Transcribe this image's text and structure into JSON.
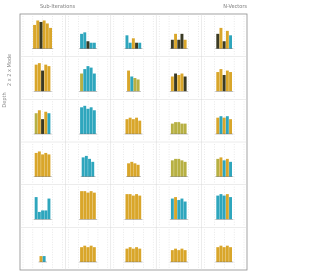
{
  "figure": {
    "top_left_text": "Sub-Iterations",
    "top_right_text": "N-Vectors",
    "row_group_labels": [
      "2 x 2 x Mode",
      "Depth"
    ],
    "col_labels": [
      "",
      "",
      "",
      "",
      ""
    ],
    "row_labels": [
      "",
      "",
      "",
      "",
      "",
      ""
    ],
    "colors": {
      "gold": "#d9a62a",
      "dark": "#3a3a24",
      "olive": "#b7b043",
      "teal": "#2ea6bd",
      "grid": "#c8c8c8",
      "frame": "#8c8c8c"
    }
  },
  "chart_data": {
    "type": "bar",
    "grid": true,
    "rows": 6,
    "cols": 5,
    "ylim": [
      0,
      1
    ],
    "panels": [
      [
        {
          "colors": [
            "gold",
            "gold",
            "dark",
            "gold",
            "gold",
            "gold"
          ],
          "values": [
            0.8,
            0.95,
            0.9,
            0.95,
            0.85,
            0.7
          ]
        },
        {
          "colors": [
            "teal",
            "teal",
            "dark",
            "teal",
            "teal"
          ],
          "values": [
            0.5,
            0.55,
            0.25,
            0.2,
            0.2
          ]
        },
        {
          "colors": [
            "teal",
            "teal",
            "gold",
            "dark",
            "teal"
          ],
          "values": [
            0.45,
            0.2,
            0.35,
            0.2,
            0.2
          ]
        },
        {
          "colors": [
            "dark",
            "gold",
            "dark",
            "dark",
            "gold"
          ],
          "values": [
            0.3,
            0.5,
            0.3,
            0.5,
            0.3
          ]
        },
        {
          "colors": [
            "dark",
            "gold",
            "dark",
            "gold",
            "teal"
          ],
          "values": [
            0.5,
            0.7,
            0.25,
            0.6,
            0.45
          ]
        }
      ],
      [
        {
          "colors": [
            "gold",
            "gold",
            "dark",
            "gold",
            "gold"
          ],
          "values": [
            0.9,
            0.95,
            0.7,
            0.9,
            0.85
          ]
        },
        {
          "colors": [
            "olive",
            "teal",
            "teal",
            "teal",
            "teal"
          ],
          "values": [
            0.6,
            0.75,
            0.85,
            0.8,
            0.6
          ]
        },
        {
          "colors": [
            "gold",
            "teal",
            "olive",
            "olive"
          ],
          "values": [
            0.7,
            0.5,
            0.45,
            0.4
          ]
        },
        {
          "colors": [
            "gold",
            "dark",
            "gold",
            "gold",
            "dark"
          ],
          "values": [
            0.5,
            0.6,
            0.55,
            0.6,
            0.5
          ]
        },
        {
          "colors": [
            "gold",
            "gold",
            "dark",
            "gold",
            "gold"
          ],
          "values": [
            0.65,
            0.75,
            0.55,
            0.7,
            0.65
          ]
        }
      ],
      [
        {
          "colors": [
            "olive",
            "gold",
            "dark",
            "gold",
            "teal"
          ],
          "values": [
            0.7,
            0.8,
            0.5,
            0.75,
            0.7
          ]
        },
        {
          "colors": [
            "teal",
            "teal",
            "teal",
            "teal",
            "teal"
          ],
          "values": [
            0.9,
            0.95,
            0.85,
            0.9,
            0.8
          ]
        },
        {
          "colors": [
            "gold",
            "gold",
            "gold",
            "gold",
            "gold"
          ],
          "values": [
            0.5,
            0.55,
            0.5,
            0.55,
            0.45
          ]
        },
        {
          "colors": [
            "olive",
            "olive",
            "olive",
            "olive",
            "olive"
          ],
          "values": [
            0.35,
            0.4,
            0.4,
            0.35,
            0.35
          ]
        },
        {
          "colors": [
            "gold",
            "teal",
            "gold",
            "teal",
            "gold"
          ],
          "values": [
            0.55,
            0.6,
            0.55,
            0.6,
            0.5
          ]
        }
      ],
      [
        {
          "colors": [
            "gold",
            "gold",
            "gold",
            "gold",
            "gold"
          ],
          "values": [
            0.8,
            0.85,
            0.75,
            0.8,
            0.75
          ]
        },
        {
          "colors": [
            "teal",
            "teal",
            "teal",
            "teal"
          ],
          "values": [
            0.65,
            0.7,
            0.6,
            0.5
          ]
        },
        {
          "colors": [
            "gold",
            "gold",
            "gold",
            "gold"
          ],
          "values": [
            0.45,
            0.5,
            0.45,
            0.4
          ]
        },
        {
          "colors": [
            "olive",
            "olive",
            "olive",
            "olive",
            "olive"
          ],
          "values": [
            0.55,
            0.6,
            0.6,
            0.55,
            0.5
          ]
        },
        {
          "colors": [
            "olive",
            "gold",
            "teal",
            "gold",
            "teal"
          ],
          "values": [
            0.6,
            0.65,
            0.55,
            0.6,
            0.5
          ]
        }
      ],
      [
        {
          "colors": [
            "teal",
            "teal",
            "teal",
            "teal",
            "teal"
          ],
          "values": [
            0.75,
            0.25,
            0.3,
            0.3,
            0.7
          ]
        },
        {
          "colors": [
            "gold",
            "gold",
            "gold",
            "gold",
            "gold"
          ],
          "values": [
            0.95,
            0.95,
            0.9,
            0.95,
            0.9
          ]
        },
        {
          "colors": [
            "gold",
            "gold",
            "gold",
            "gold",
            "gold"
          ],
          "values": [
            0.85,
            0.85,
            0.8,
            0.85,
            0.8
          ]
        },
        {
          "colors": [
            "teal",
            "gold",
            "teal",
            "teal",
            "teal"
          ],
          "values": [
            0.7,
            0.75,
            0.65,
            0.7,
            0.6
          ]
        },
        {
          "colors": [
            "teal",
            "teal",
            "teal",
            "gold",
            "teal"
          ],
          "values": [
            0.8,
            0.85,
            0.8,
            0.85,
            0.75
          ]
        }
      ],
      [
        {
          "colors": [
            "gold",
            "teal"
          ],
          "values": [
            0.2,
            0.2
          ]
        },
        {
          "colors": [
            "gold",
            "gold",
            "gold",
            "gold",
            "gold"
          ],
          "values": [
            0.5,
            0.55,
            0.5,
            0.55,
            0.5
          ]
        },
        {
          "colors": [
            "gold",
            "gold",
            "gold",
            "gold",
            "gold"
          ],
          "values": [
            0.45,
            0.5,
            0.45,
            0.5,
            0.45
          ]
        },
        {
          "colors": [
            "gold",
            "gold",
            "gold",
            "gold",
            "gold"
          ],
          "values": [
            0.4,
            0.45,
            0.4,
            0.45,
            0.4
          ]
        },
        {
          "colors": [
            "gold",
            "gold",
            "gold",
            "gold",
            "gold"
          ],
          "values": [
            0.5,
            0.55,
            0.5,
            0.55,
            0.5
          ]
        }
      ]
    ]
  }
}
